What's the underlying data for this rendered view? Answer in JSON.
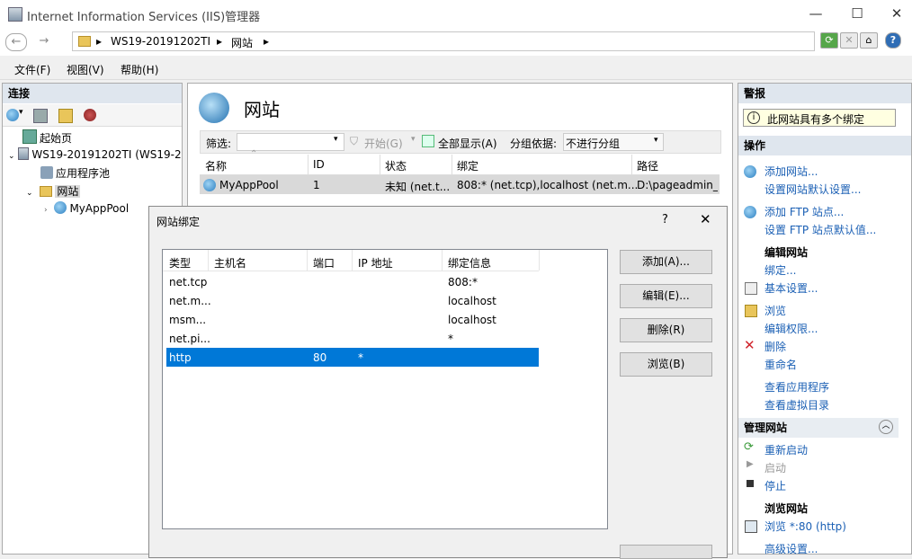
{
  "window": {
    "title": "Internet Information Services (IIS)管理器",
    "minimize": "—",
    "maximize": "☐",
    "close": "✕"
  },
  "address": {
    "crumbs": [
      "WS19-20191202TI",
      "网站"
    ],
    "back": "←",
    "forward": "→",
    "help": "?"
  },
  "menu": [
    "文件(F)",
    "视图(V)",
    "帮助(H)"
  ],
  "connections": {
    "header": "连接",
    "tree": [
      {
        "label": "起始页",
        "icon": "start-page-icon"
      },
      {
        "label": "WS19-20191202TI (WS19-2",
        "icon": "server-icon"
      },
      {
        "label": "应用程序池",
        "icon": "app-pool-icon"
      },
      {
        "label": "网站",
        "icon": "folder-icon"
      },
      {
        "label": "MyAppPool",
        "icon": "globe-icon"
      }
    ]
  },
  "center": {
    "title": "网站",
    "filter_label": "筛选:",
    "start_label": "开始(G)",
    "showall_label": "全部显示(A)",
    "groupby_label": "分组依据:",
    "groupby_value": "不进行分组",
    "columns": [
      "名称",
      "ID",
      "状态",
      "绑定",
      "路径"
    ],
    "rows": [
      {
        "name": "MyAppPool",
        "id": "1",
        "state": "未知 (net.t...",
        "binding": "808:* (net.tcp),localhost (net.m...",
        "path": "D:\\pageadmin_v"
      }
    ]
  },
  "dialog": {
    "title": "网站绑定",
    "help": "?",
    "close": "✕",
    "columns": [
      "类型",
      "主机名",
      "端口",
      "IP 地址",
      "绑定信息"
    ],
    "rows": [
      {
        "type": "net.tcp",
        "host": "",
        "port": "",
        "ip": "",
        "info": "808:*"
      },
      {
        "type": "net.m...",
        "host": "",
        "port": "",
        "ip": "",
        "info": "localhost"
      },
      {
        "type": "msm...",
        "host": "",
        "port": "",
        "ip": "",
        "info": "localhost"
      },
      {
        "type": "net.pi...",
        "host": "",
        "port": "",
        "ip": "",
        "info": "*"
      },
      {
        "type": "http",
        "host": "",
        "port": "80",
        "ip": "*",
        "info": ""
      }
    ],
    "buttons": [
      "添加(A)...",
      "编辑(E)...",
      "删除(R)",
      "浏览(B)"
    ],
    "selected_color": "#0078d7"
  },
  "alerts": {
    "header": "警报",
    "message": "此网站具有多个绑定"
  },
  "actions": {
    "header": "操作",
    "items": {
      "add_site": "添加网站...",
      "set_defaults": "设置网站默认设置...",
      "add_ftp": "添加 FTP 站点...",
      "ftp_defaults": "设置 FTP 站点默认值...",
      "edit_site": "编辑网站",
      "bindings": "绑定...",
      "basic": "基本设置...",
      "browse": "浏览",
      "edit_perm": "编辑权限...",
      "delete": "删除",
      "rename": "重命名",
      "view_apps": "查看应用程序",
      "view_vdirs": "查看虚拟目录",
      "manage_site": "管理网站",
      "restart": "重新启动",
      "start": "启动",
      "stop": "停止",
      "browse_site": "浏览网站",
      "browse_80": "浏览 *:80 (http)",
      "advanced": "高级设置..."
    }
  }
}
